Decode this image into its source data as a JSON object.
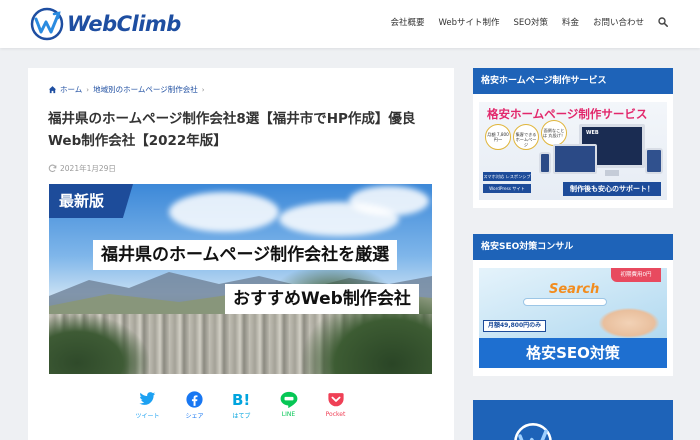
{
  "header": {
    "brand": "WebClimb",
    "nav": [
      "会社概要",
      "Webサイト制作",
      "SEO対策",
      "料金",
      "お問い合わせ"
    ]
  },
  "breadcrumb": {
    "items": [
      "ホーム",
      "地域別のホームページ制作会社"
    ]
  },
  "article": {
    "title": "福井県のホームページ制作会社8選【福井市でHP作成】優良Web制作会社【2022年版】",
    "date": "2021年1月29日",
    "hero": {
      "badge": "最新版",
      "line1": "福井県のホームページ制作会社を厳選",
      "line2": "おすすめWeb制作会社"
    },
    "share": [
      {
        "label": "ツイート",
        "icon": "twitter-icon",
        "color": "#1da1f2"
      },
      {
        "label": "シェア",
        "icon": "facebook-icon",
        "color": "#1877f2"
      },
      {
        "label": "はてブ",
        "icon": "hatena-bookmark-icon",
        "color": "#00a4de"
      },
      {
        "label": "LINE",
        "icon": "line-icon",
        "color": "#06c755"
      },
      {
        "label": "Pocket",
        "icon": "pocket-icon",
        "color": "#ef4056"
      }
    ]
  },
  "sidebar": {
    "widget1": {
      "title": "格安ホームページ制作サービス",
      "banner_title": "格安ホームページ制作サービス",
      "circle1": "月額 7,800円〜",
      "circle2": "集客できる ホームページ",
      "circle3": "面倒なことは 丸投げ！",
      "pill1": "スマホ対応 レスポンシブ",
      "pill2": "WordPress サイト",
      "footer": "制作後も安心のサポート！",
      "monitor_label": "WEB"
    },
    "widget2": {
      "title": "格安SEO対策コンサル",
      "search_word": "Search",
      "badge": "初期費用0円",
      "price": "月額49,800円のみ",
      "footer": "格安SEO対策"
    }
  },
  "colors": {
    "brand_blue": "#1e4ea1",
    "widget_header": "#1e63b8",
    "accent_pink": "#e2286c"
  }
}
